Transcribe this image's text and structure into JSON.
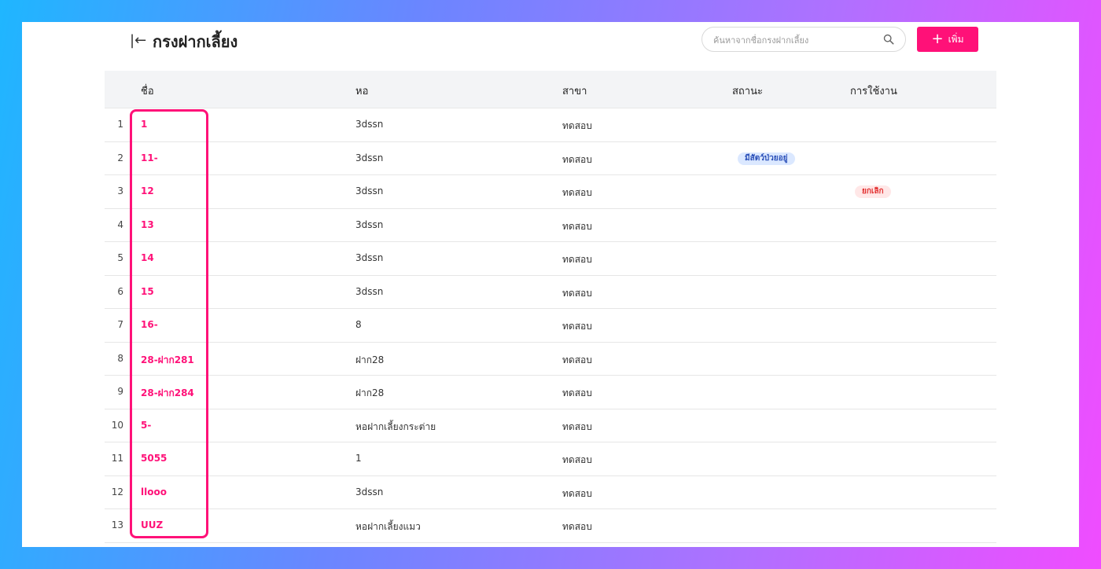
{
  "header": {
    "back_icon": "collapse-left-icon",
    "title": "กรงฝากเลี้ยง",
    "search_placeholder": "ค้นหาจากชื่อกรงฝากเลี้ยง",
    "search_icon": "search-icon",
    "add_label": "เพิ่ม"
  },
  "table": {
    "columns": [
      "ชื่อ",
      "หอ",
      "สาขา",
      "สถานะ",
      "การใช้งาน"
    ],
    "rows": [
      {
        "index": "1",
        "name": "1",
        "dorm": "3dssn",
        "branch": "ทดสอบ",
        "status": "",
        "usage": ""
      },
      {
        "index": "2",
        "name": "11-",
        "dorm": "3dssn",
        "branch": "ทดสอบ",
        "status": "มีสัตว์ป่วยอยู่",
        "usage": ""
      },
      {
        "index": "3",
        "name": "12",
        "dorm": "3dssn",
        "branch": "ทดสอบ",
        "status": "",
        "usage": "ยกเลิก"
      },
      {
        "index": "4",
        "name": "13",
        "dorm": "3dssn",
        "branch": "ทดสอบ",
        "status": "",
        "usage": ""
      },
      {
        "index": "5",
        "name": "14",
        "dorm": "3dssn",
        "branch": "ทดสอบ",
        "status": "",
        "usage": ""
      },
      {
        "index": "6",
        "name": "15",
        "dorm": "3dssn",
        "branch": "ทดสอบ",
        "status": "",
        "usage": ""
      },
      {
        "index": "7",
        "name": "16-",
        "dorm": "8",
        "branch": "ทดสอบ",
        "status": "",
        "usage": ""
      },
      {
        "index": "8",
        "name": "28-ฝาก281",
        "dorm": "ฝาก28",
        "branch": "ทดสอบ",
        "status": "",
        "usage": ""
      },
      {
        "index": "9",
        "name": "28-ฝาก284",
        "dorm": "ฝาก28",
        "branch": "ทดสอบ",
        "status": "",
        "usage": ""
      },
      {
        "index": "10",
        "name": "5-",
        "dorm": "หอฝากเลี้ยงกระต่าย",
        "branch": "ทดสอบ",
        "status": "",
        "usage": ""
      },
      {
        "index": "11",
        "name": "5055",
        "dorm": "1",
        "branch": "ทดสอบ",
        "status": "",
        "usage": ""
      },
      {
        "index": "12",
        "name": "llooo",
        "dorm": "3dssn",
        "branch": "ทดสอบ",
        "status": "",
        "usage": ""
      },
      {
        "index": "13",
        "name": "UUZ",
        "dorm": "หอฝากเลี้ยงแมว",
        "branch": "ทดสอบ",
        "status": "",
        "usage": ""
      }
    ]
  },
  "colors": {
    "accent": "#ff1178",
    "status_badge_bg": "#dbe8ff",
    "cancel_badge_bg": "#ffe7e7",
    "header_bg": "#f3f4f6"
  }
}
